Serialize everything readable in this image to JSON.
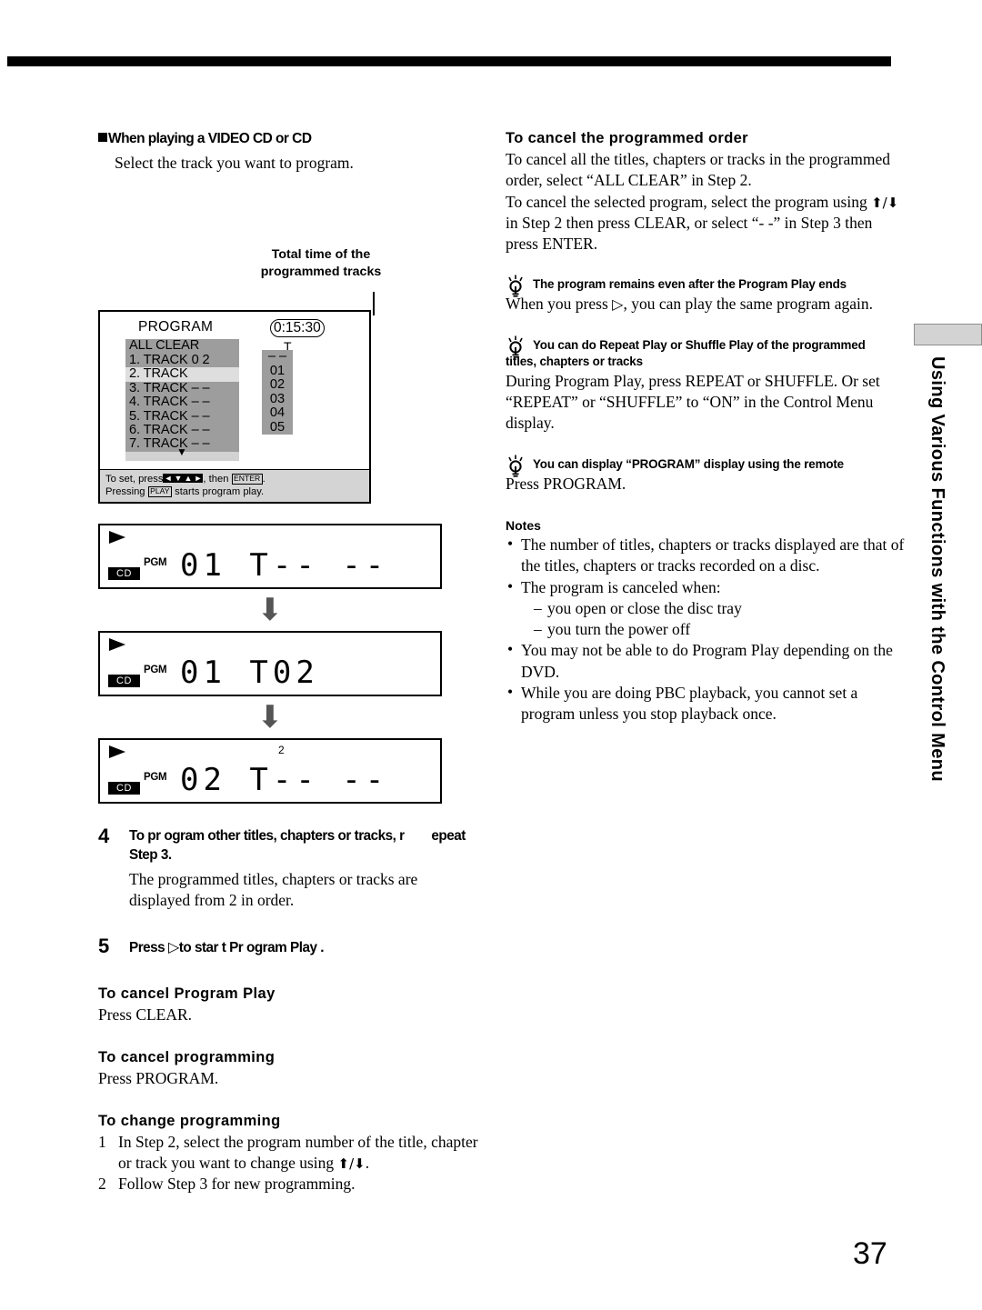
{
  "page_number": "37",
  "side_tab": {
    "label": "Using Various Functions with the Control Menu"
  },
  "left_column": {
    "section_heading": "When playing a VIDEO CD or CD",
    "section_body": "Select the track you want to program.",
    "callout": "Total time of the\nprogrammed tracks",
    "program_display": {
      "title": "PROGRAM",
      "total_time": "0:15:30",
      "t_mark": "T",
      "list_items": [
        "ALL CLEAR",
        "1. TRACK  0 2",
        "2. TRACK",
        "3. TRACK – –",
        "4. TRACK – –",
        "5. TRACK – –",
        "6. TRACK – –",
        "7. TRACK – –"
      ],
      "highlighted_index": 2,
      "numbers": [
        "– –",
        "01",
        "02",
        "03",
        "04",
        "05"
      ],
      "footer_line1_a": "To set, press",
      "footer_line1_keys": [
        "◄",
        "▼",
        "▲",
        "►"
      ],
      "footer_line1_b": ", then",
      "footer_line1_enter": "ENTER",
      "footer_line1_c": ".",
      "footer_line2_a": "Pressing",
      "footer_line2_key": "PLAY",
      "footer_line2_b": "starts program play."
    },
    "lcd_displays": [
      {
        "cd_badge": "CD",
        "pgm": "PGM",
        "segments": "01  T-- --",
        "small_number": ""
      },
      {
        "cd_badge": "CD",
        "pgm": "PGM",
        "segments": "01  T02",
        "small_number": ""
      },
      {
        "cd_badge": "CD",
        "pgm": "PGM",
        "segments": "02  T-- --",
        "small_number": "2"
      }
    ],
    "step4": {
      "number": "4",
      "heading_line1": "To pr ogram other titles, chapters or tracks, r",
      "heading_line1b": "epeat",
      "heading_line2": "Step 3.",
      "body": "The programmed titles, chapters or tracks are displayed from 2 in order."
    },
    "step5": {
      "number": "5",
      "heading_a": "Press",
      "heading_b": "to star t Pr ogram Play ."
    },
    "cancel_program_play": {
      "heading": "To cancel Program Play",
      "body": "Press CLEAR."
    },
    "cancel_programming": {
      "heading": "To cancel programming",
      "body": "Press PROGRAM."
    },
    "change_programming": {
      "heading": "To change programming",
      "items": [
        {
          "mark": "1",
          "text_a": "In Step 2, select the program number of the title, chapter or track you want to change using ",
          "text_b": "."
        },
        {
          "mark": "2",
          "text_a": "Follow Step 3 for new programming.",
          "text_b": ""
        }
      ]
    }
  },
  "right_column": {
    "cancel_order": {
      "heading": "To cancel the programmed order",
      "para1": "To cancel all the titles, chapters or tracks in the programmed order, select “ALL CLEAR” in Step 2.",
      "para2_a": "To cancel the selected program,  select the program using ",
      "para2_b": " in Step 2 then press CLEAR, or select “- -” in Step 3 then press ENTER."
    },
    "tips": [
      {
        "heading": "The program remains even after the Program Play ends",
        "heading2": "",
        "body_a": "When you press ",
        "body_b": ", you can play the same program again."
      },
      {
        "heading": "You can do Repeat Play or Shuffle Play of the programmed",
        "heading2": "titles, chapters or tracks",
        "body_a": "During Program Play, press REPEAT or SHUFFLE.  Or set “REPEAT” or “SHUFFLE” to “ON” in the Control Menu display.",
        "body_b": ""
      },
      {
        "heading": "You can display “PROGRAM” display using the remote",
        "heading2": "",
        "body_a": "Press PROGRAM.",
        "body_b": ""
      }
    ],
    "notes_heading": "Notes",
    "notes": [
      {
        "text": "The number of titles, chapters or tracks displayed are that of the titles, chapters or tracks recorded on a disc.",
        "sub": []
      },
      {
        "text": "The program is canceled when:",
        "sub": [
          "you open or close the disc tray",
          "you turn the power off"
        ]
      },
      {
        "text": "You may not be able to do Program Play depending on the DVD.",
        "sub": []
      },
      {
        "text": "While you are doing PBC playback, you cannot set a program unless you stop playback once.",
        "sub": []
      }
    ]
  }
}
